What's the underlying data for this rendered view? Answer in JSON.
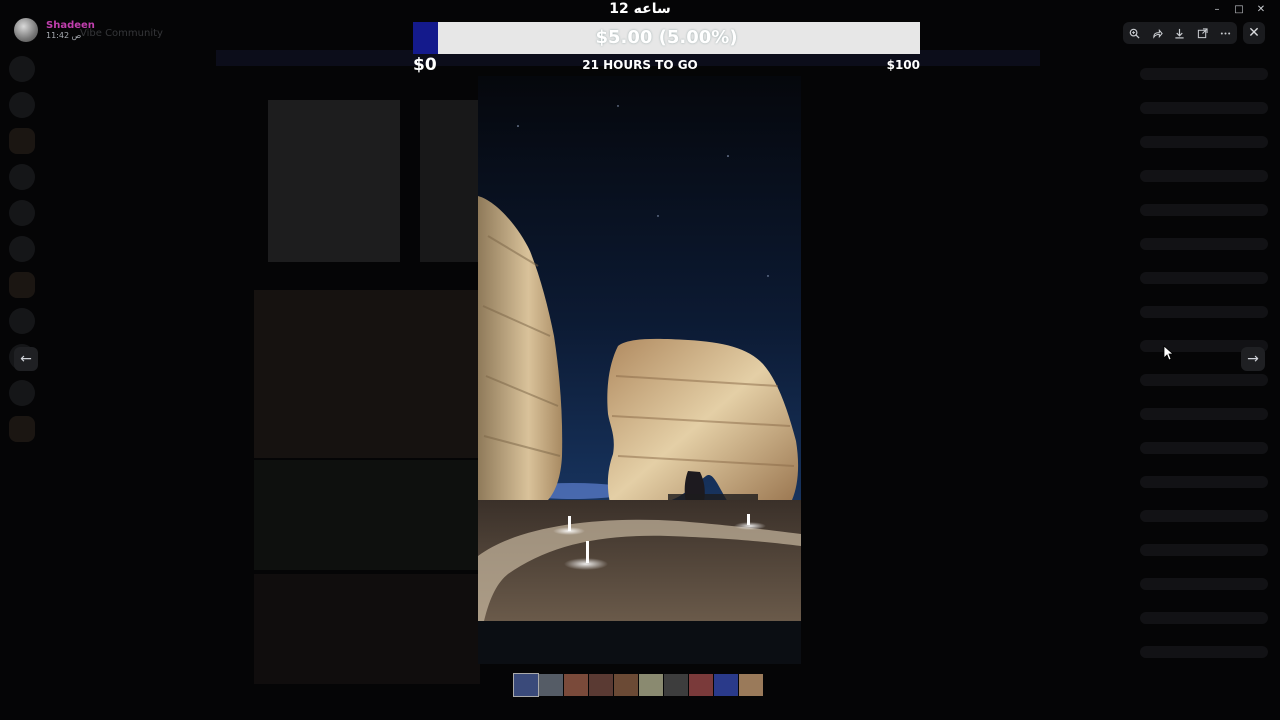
{
  "user": {
    "name": "Shadeen",
    "time": "11:42 ص"
  },
  "server": {
    "name": "Vibe Community"
  },
  "overlay": {
    "title": "ساعه 12",
    "progress_text": "$5.00 (5.00%)",
    "progress_fraction": 0.05,
    "min_label": "$0",
    "max_label": "$100",
    "time_left": "21 HOURS TO GO",
    "fill_color": "#141a8c"
  },
  "window_controls": {
    "minimize": "–",
    "maximize": "□",
    "close": "✕"
  },
  "toolbar": {
    "icons": [
      "zoom-in-icon",
      "forward-icon",
      "download-icon",
      "open-external-icon",
      "more-icon"
    ]
  },
  "viewer": {
    "close": "✕",
    "prev": "←",
    "next": "→"
  },
  "thumbnails": {
    "count": 10,
    "colors": [
      "#3a4a7a",
      "#555c66",
      "#7a4a3a",
      "#5a3a33",
      "#6b4a35",
      "#8a8a70",
      "#3d3d3d",
      "#7a3a3a",
      "#2a3a8a",
      "#9a7a5a"
    ]
  }
}
